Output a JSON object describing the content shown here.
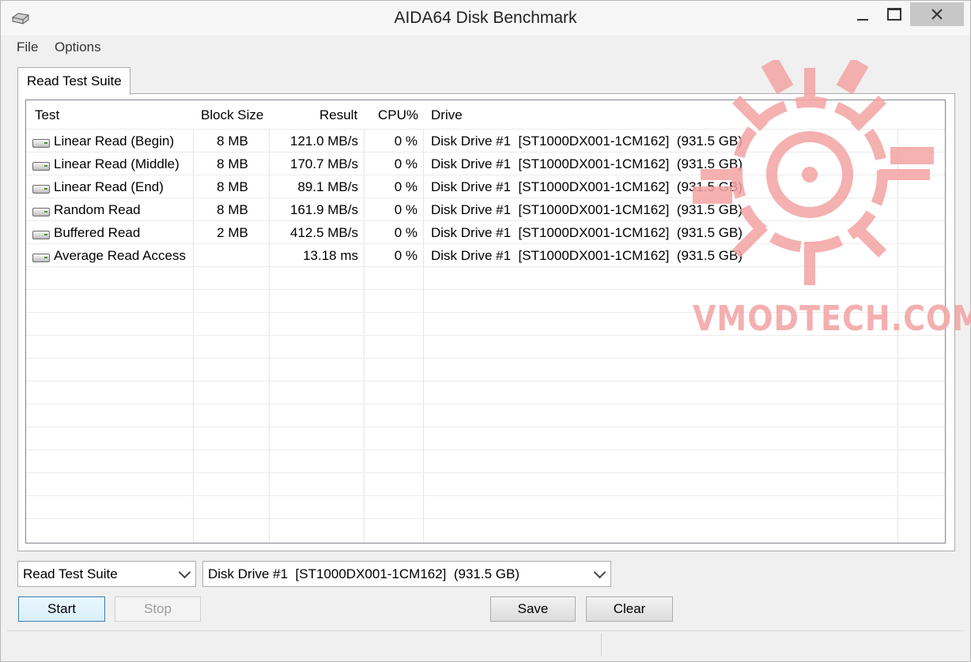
{
  "window": {
    "title": "AIDA64 Disk Benchmark",
    "icons": {
      "app": "disk-drive-icon",
      "minimize": "minimize-icon",
      "maximize": "maximize-icon",
      "close": "close-icon"
    }
  },
  "menu": {
    "items": [
      "File",
      "Options"
    ]
  },
  "tabs": [
    {
      "label": "Read Test Suite",
      "active": true
    }
  ],
  "table": {
    "headers": [
      "Test",
      "Block Size",
      "Result",
      "CPU%",
      "Drive"
    ],
    "rows": [
      {
        "test": "Linear Read (Begin)",
        "block": "8 MB",
        "result": "121.0 MB/s",
        "cpu": "0 %",
        "drive": "Disk Drive #1  [ST1000DX001-1CM162]  (931.5 GB)"
      },
      {
        "test": "Linear Read (Middle)",
        "block": "8 MB",
        "result": "170.7 MB/s",
        "cpu": "0 %",
        "drive": "Disk Drive #1  [ST1000DX001-1CM162]  (931.5 GB)"
      },
      {
        "test": "Linear Read (End)",
        "block": "8 MB",
        "result": "89.1 MB/s",
        "cpu": "0 %",
        "drive": "Disk Drive #1  [ST1000DX001-1CM162]  (931.5 GB)"
      },
      {
        "test": "Random Read",
        "block": "8 MB",
        "result": "161.9 MB/s",
        "cpu": "0 %",
        "drive": "Disk Drive #1  [ST1000DX001-1CM162]  (931.5 GB)"
      },
      {
        "test": "Buffered Read",
        "block": "2 MB",
        "result": "412.5 MB/s",
        "cpu": "0 %",
        "drive": "Disk Drive #1  [ST1000DX001-1CM162]  (931.5 GB)"
      },
      {
        "test": "Average Read Access",
        "block": "",
        "result": "13.18 ms",
        "cpu": "0 %",
        "drive": "Disk Drive #1  [ST1000DX001-1CM162]  (931.5 GB)"
      }
    ],
    "row_icon": "disk-drive-icon"
  },
  "controls": {
    "suite_select": "Read Test Suite",
    "drive_select": "Disk Drive #1  [ST1000DX001-1CM162]  (931.5 GB)",
    "buttons": {
      "start": "Start",
      "stop": "Stop",
      "save": "Save",
      "clear": "Clear"
    },
    "stop_disabled": true
  },
  "watermark": {
    "text": "VMODTECH.COM",
    "color": "#f3a7a7"
  }
}
